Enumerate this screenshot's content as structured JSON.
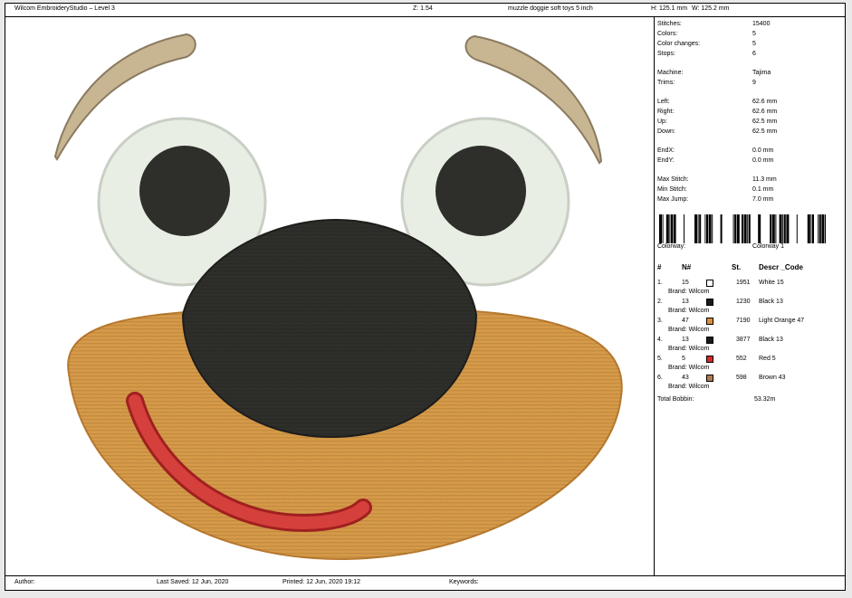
{
  "header": {
    "app_title": "Wilcom EmbroideryStudio – Level 3",
    "zoom": "Z: 1.54",
    "design_name": "muzzle doggie soft toys 5 inch",
    "height": "H: 125.1 mm",
    "width": "W: 125.2 mm"
  },
  "stats": [
    {
      "label": "Stitches:",
      "value": "15400"
    },
    {
      "label": "Colors:",
      "value": "5"
    },
    {
      "label": "Color changes:",
      "value": "5"
    },
    {
      "label": "Stops:",
      "value": "6"
    },
    {
      "label": "Machine:",
      "value": "Tajima"
    },
    {
      "label": "Trims:",
      "value": "9"
    },
    {
      "label": "Left:",
      "value": "62.6 mm"
    },
    {
      "label": "Right:",
      "value": "62.6 mm"
    },
    {
      "label": "Up:",
      "value": "62.5 mm"
    },
    {
      "label": "Down:",
      "value": "62.5 mm"
    },
    {
      "label": "EndX:",
      "value": "0.0 mm"
    },
    {
      "label": "EndY:",
      "value": "0.0 mm"
    },
    {
      "label": "Max Stitch:",
      "value": "11.3 mm"
    },
    {
      "label": "Min Stitch:",
      "value": "0.1 mm"
    },
    {
      "label": "Max Jump:",
      "value": "7.0 mm"
    }
  ],
  "colorway": {
    "label": "Colorway:",
    "value": "Colorway 1"
  },
  "table": {
    "headers": {
      "num": "#",
      "n": "N#",
      "st": "St.",
      "descr": "Descr _Code"
    },
    "rows": [
      {
        "idx": "1.",
        "n": "15",
        "color": "#ffffff",
        "st": "1951",
        "descr": "White 15",
        "brand": "Brand: Wilcom"
      },
      {
        "idx": "2.",
        "n": "13",
        "color": "#1a1a1a",
        "st": "1230",
        "descr": "Black 13",
        "brand": "Brand: Wilcom"
      },
      {
        "idx": "3.",
        "n": "47",
        "color": "#d9903f",
        "st": "7190",
        "descr": "Light Orange 47",
        "brand": "Brand: Wilcom"
      },
      {
        "idx": "4.",
        "n": "13",
        "color": "#1a1a1a",
        "st": "3877",
        "descr": "Black 13",
        "brand": "Brand: Wilcom"
      },
      {
        "idx": "5.",
        "n": "5",
        "color": "#d42a2a",
        "st": "552",
        "descr": "Red 5",
        "brand": "Brand: Wilcom"
      },
      {
        "idx": "6.",
        "n": "43",
        "color": "#b07b52",
        "st": "598",
        "descr": "Brown 43",
        "brand": "Brand: Wilcom"
      }
    ],
    "total_label": "Total Bobbin:",
    "total_value": "53.32m"
  },
  "footer": {
    "author": "Author:",
    "last_saved": "Last Saved: 12 Jun, 2020",
    "printed": "Printed: 12 Jun, 2020 19:12",
    "keywords": "Keywords:"
  },
  "colors": {
    "brow": "#c8b592",
    "eye_white": "#e9eee4",
    "pupil": "#2e2e2b",
    "muzzle": "#d69a48",
    "mouth": "#d6403c"
  }
}
